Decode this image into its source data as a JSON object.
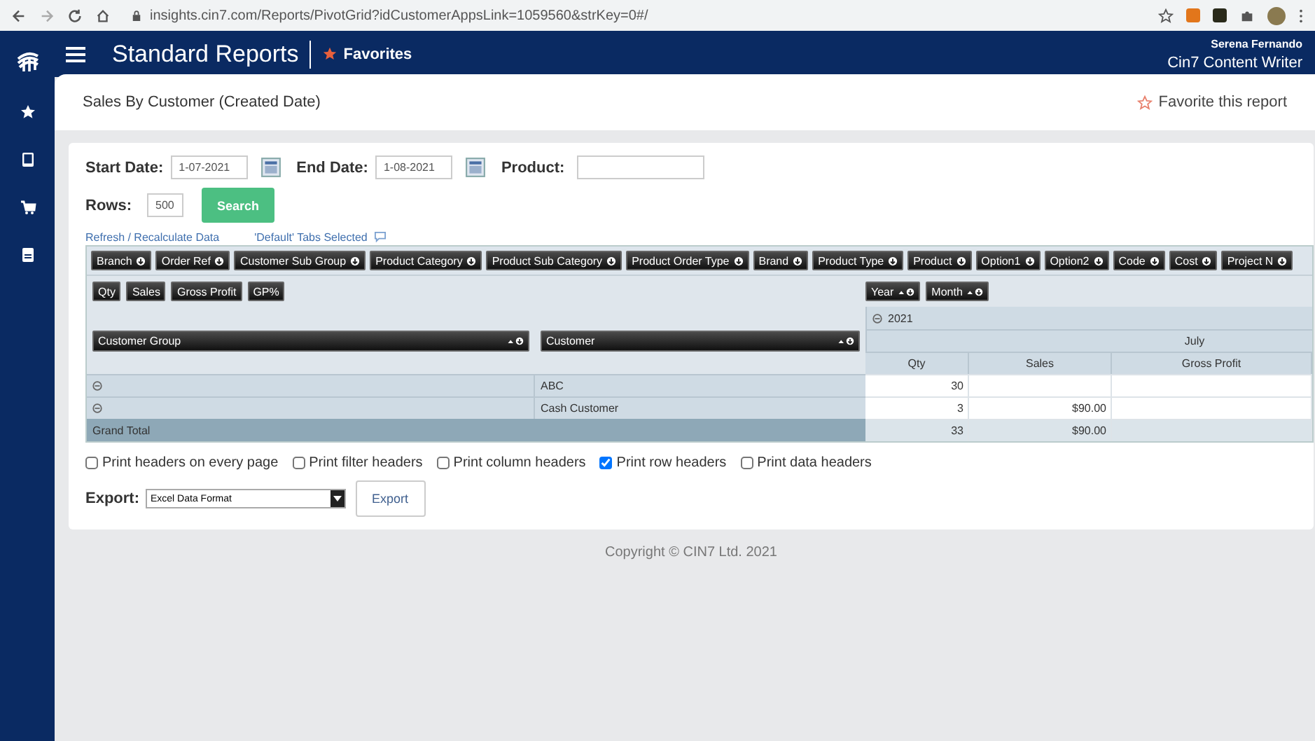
{
  "browser": {
    "url": "insights.cin7.com/Reports/PivotGrid?idCustomerAppsLink=1059560&strKey=0#/"
  },
  "header": {
    "title": "Standard Reports",
    "favorites": "Favorites",
    "user": "Serena Fernando",
    "role": "Cin7 Content Writer"
  },
  "page": {
    "title": "Sales By Customer (Created Date)",
    "favorite_link": "Favorite this report"
  },
  "filters": {
    "start_label": "Start Date:",
    "start_value": "1-07-2021",
    "end_label": "End Date:",
    "end_value": "1-08-2021",
    "product_label": "Product:",
    "rows_label": "Rows:",
    "rows_value": "500",
    "search_button": "Search"
  },
  "links": {
    "refresh": "Refresh / Recalculate Data",
    "tabs": "'Default' Tabs Selected"
  },
  "pivot": {
    "filter_fields": [
      "Branch",
      "Order Ref",
      "Customer Sub Group",
      "Product Category",
      "Product Sub Category",
      "Product Order Type",
      "Brand",
      "Product Type",
      "Product",
      "Option1",
      "Option2",
      "Code",
      "Cost",
      "Project N"
    ],
    "data_fields": [
      "Qty",
      "Sales",
      "Gross Profit",
      "GP%"
    ],
    "column_fields": [
      "Year",
      "Month"
    ],
    "row_fields": [
      "Customer Group",
      "Customer"
    ],
    "year": "2021",
    "month": "July",
    "measures": [
      "Qty",
      "Sales",
      "Gross Profit"
    ],
    "rows": [
      {
        "customer": "ABC",
        "qty": "30"
      },
      {
        "customer": "Cash Customer",
        "qty": "3",
        "sales": "$90.00"
      }
    ],
    "grand_total": {
      "label": "Grand Total",
      "qty": "33",
      "sales": "$90.00"
    }
  },
  "print_options": [
    {
      "label": "Print headers on every page",
      "checked": false
    },
    {
      "label": "Print filter headers",
      "checked": false
    },
    {
      "label": "Print column headers",
      "checked": false
    },
    {
      "label": "Print row headers",
      "checked": true
    },
    {
      "label": "Print data headers",
      "checked": false
    }
  ],
  "export": {
    "label": "Export:",
    "format": "Excel Data Format",
    "button": "Export"
  },
  "footer": {
    "copyright": "Copyright © CIN7 Ltd. 2021"
  }
}
